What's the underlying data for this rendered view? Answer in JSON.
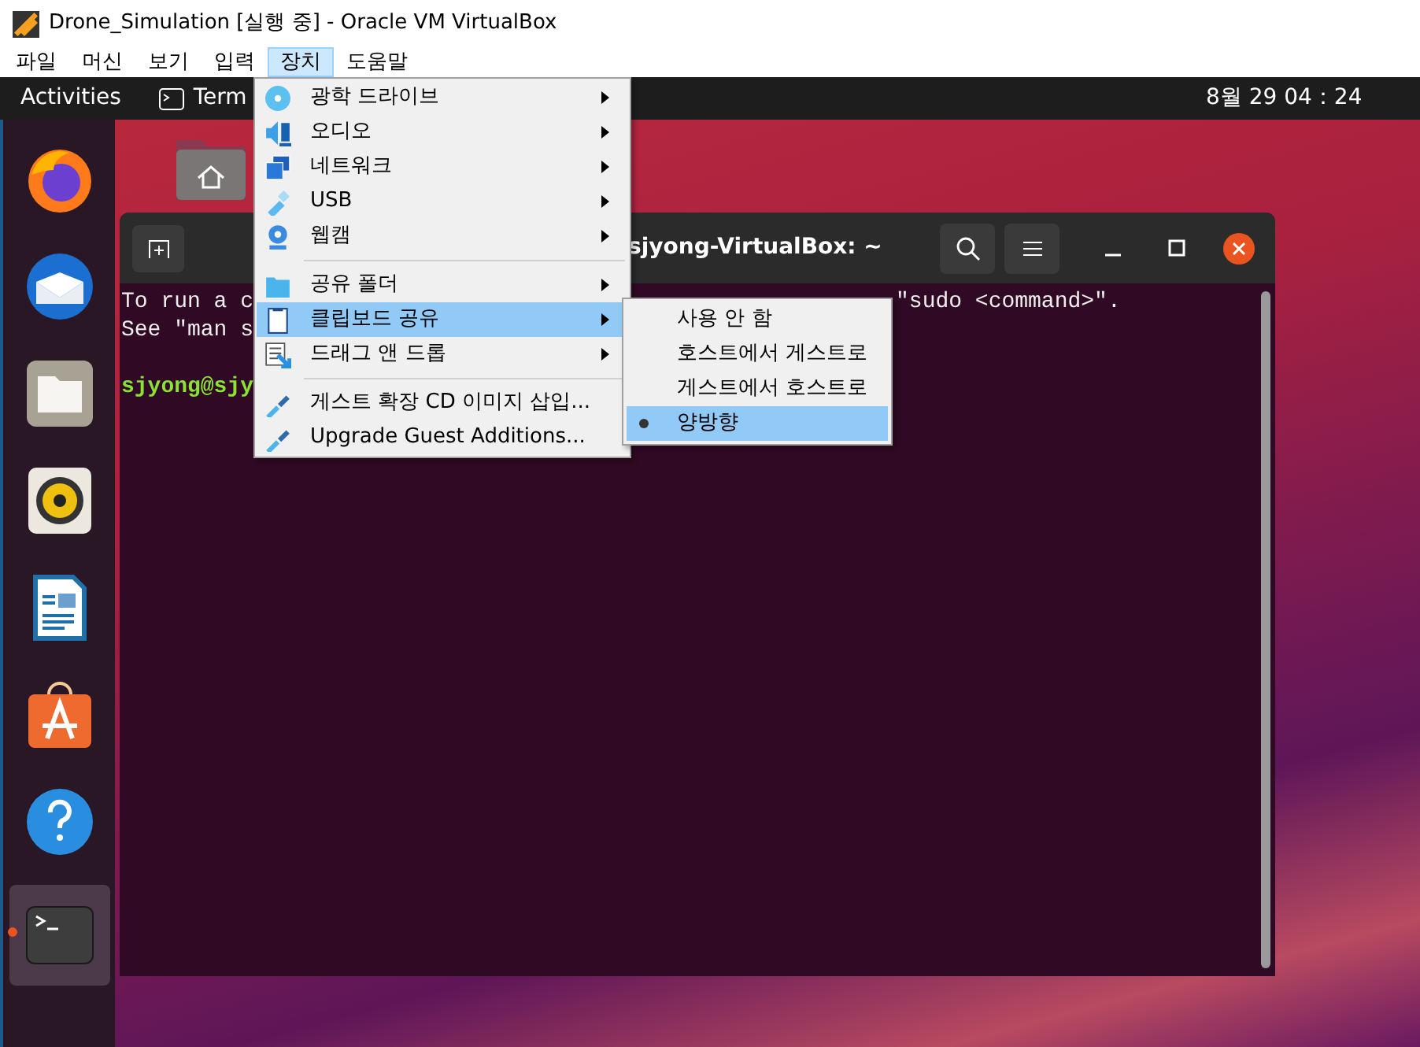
{
  "window": {
    "title": "Drone_Simulation [실행 중] - Oracle VM VirtualBox"
  },
  "menu_bar": [
    {
      "label": "파일",
      "selected": false
    },
    {
      "label": "머신",
      "selected": false
    },
    {
      "label": "보기",
      "selected": false
    },
    {
      "label": "입력",
      "selected": false
    },
    {
      "label": "장치",
      "selected": true
    },
    {
      "label": "도움말",
      "selected": false
    }
  ],
  "top_bar": {
    "activities": "Activities",
    "app_name": "Term",
    "clock": "8월 29 04：24"
  },
  "dock": [
    {
      "selected": false
    },
    {
      "selected": false
    },
    {
      "selected": false
    },
    {
      "selected": false
    },
    {
      "selected": false
    },
    {
      "selected": false
    },
    {
      "selected": false
    },
    {
      "selected": true
    }
  ],
  "terminal": {
    "title": "sjyong-VirtualBox: ~",
    "lines": [
      {
        "kind": "output",
        "left": "To run a c",
        "right": "\"sudo <command>\"."
      },
      {
        "kind": "output",
        "left": "See \"man s"
      },
      {
        "kind": "blank"
      },
      {
        "kind": "prompt",
        "left": "sjyong@sjy"
      }
    ]
  },
  "devices_menu": {
    "items": [
      {
        "kind": "item",
        "label": "광학 드라이브",
        "submenu": true,
        "selected": false
      },
      {
        "kind": "item",
        "label": "오디오",
        "submenu": true,
        "selected": false
      },
      {
        "kind": "item",
        "label": "네트워크",
        "submenu": true,
        "selected": false
      },
      {
        "kind": "item",
        "label": "USB",
        "submenu": true,
        "selected": false
      },
      {
        "kind": "item",
        "label": "웹캠",
        "submenu": true,
        "selected": false
      },
      {
        "kind": "separator"
      },
      {
        "kind": "item",
        "label": "공유 폴더",
        "submenu": true,
        "selected": false
      },
      {
        "kind": "item",
        "label": "클립보드 공유",
        "submenu": true,
        "selected": true
      },
      {
        "kind": "item",
        "label": "드래그 앤 드롭",
        "submenu": true,
        "selected": false
      },
      {
        "kind": "separator"
      },
      {
        "kind": "item",
        "label": "게스트 확장 CD 이미지 삽입...",
        "submenu": false,
        "selected": false
      },
      {
        "kind": "item",
        "label": "Upgrade Guest Additions...",
        "submenu": false,
        "selected": false
      }
    ]
  },
  "clipboard_submenu": {
    "items": [
      {
        "label": "사용 안 함",
        "checked": false,
        "selected": false
      },
      {
        "label": "호스트에서 게스트로",
        "checked": false,
        "selected": false
      },
      {
        "label": "게스트에서 호스트로",
        "checked": false,
        "selected": false
      },
      {
        "label": "양방향",
        "checked": true,
        "selected": true
      }
    ]
  }
}
